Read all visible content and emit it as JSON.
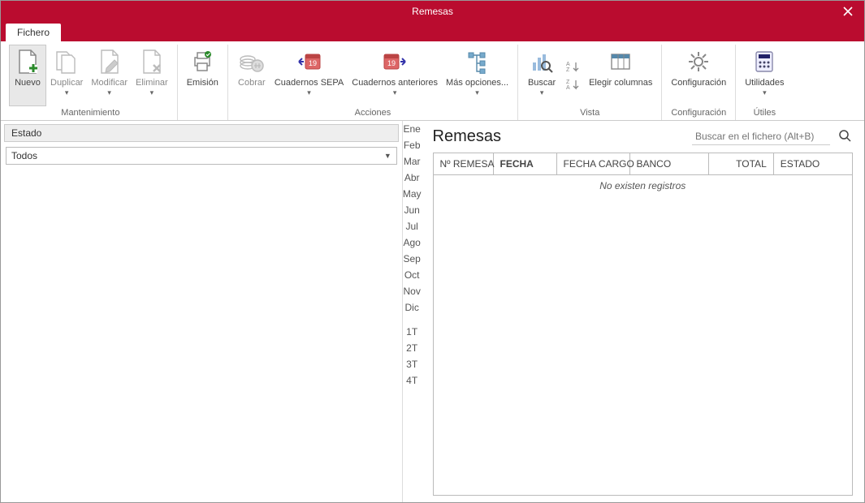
{
  "window": {
    "title": "Remesas"
  },
  "tabs": {
    "fichero": "Fichero"
  },
  "ribbon": {
    "mantenimiento": {
      "title": "Mantenimiento",
      "nuevo": "Nuevo",
      "duplicar": "Duplicar",
      "modificar": "Modificar",
      "eliminar": "Eliminar"
    },
    "emision": {
      "label": "Emisión"
    },
    "acciones": {
      "title": "Acciones",
      "cobrar": "Cobrar",
      "cuadernos_sepa": "Cuadernos SEPA",
      "cuadernos_anteriores": "Cuadernos anteriores",
      "mas_opciones": "Más opciones..."
    },
    "vista": {
      "title": "Vista",
      "buscar": "Buscar",
      "elegir_columnas": "Elegir columnas"
    },
    "configuracion": {
      "title": "Configuración",
      "label": "Configuración"
    },
    "utiles": {
      "title": "Útiles",
      "label": "Utilidades"
    }
  },
  "filter": {
    "estado_label": "Estado",
    "estado_value": "Todos",
    "months": [
      "Ene",
      "Feb",
      "Mar",
      "Abr",
      "May",
      "Jun",
      "Jul",
      "Ago",
      "Sep",
      "Oct",
      "Nov",
      "Dic"
    ],
    "quarters": [
      "1T",
      "2T",
      "3T",
      "4T"
    ]
  },
  "main": {
    "title": "Remesas",
    "search_placeholder": "Buscar en el fichero (Alt+B)",
    "columns": {
      "num": "Nº REMESA",
      "fecha": "FECHA",
      "fecha_cargo": "FECHA CARGO",
      "banco": "BANCO",
      "total": "TOTAL",
      "estado": "ESTADO"
    },
    "empty": "No existen registros"
  }
}
